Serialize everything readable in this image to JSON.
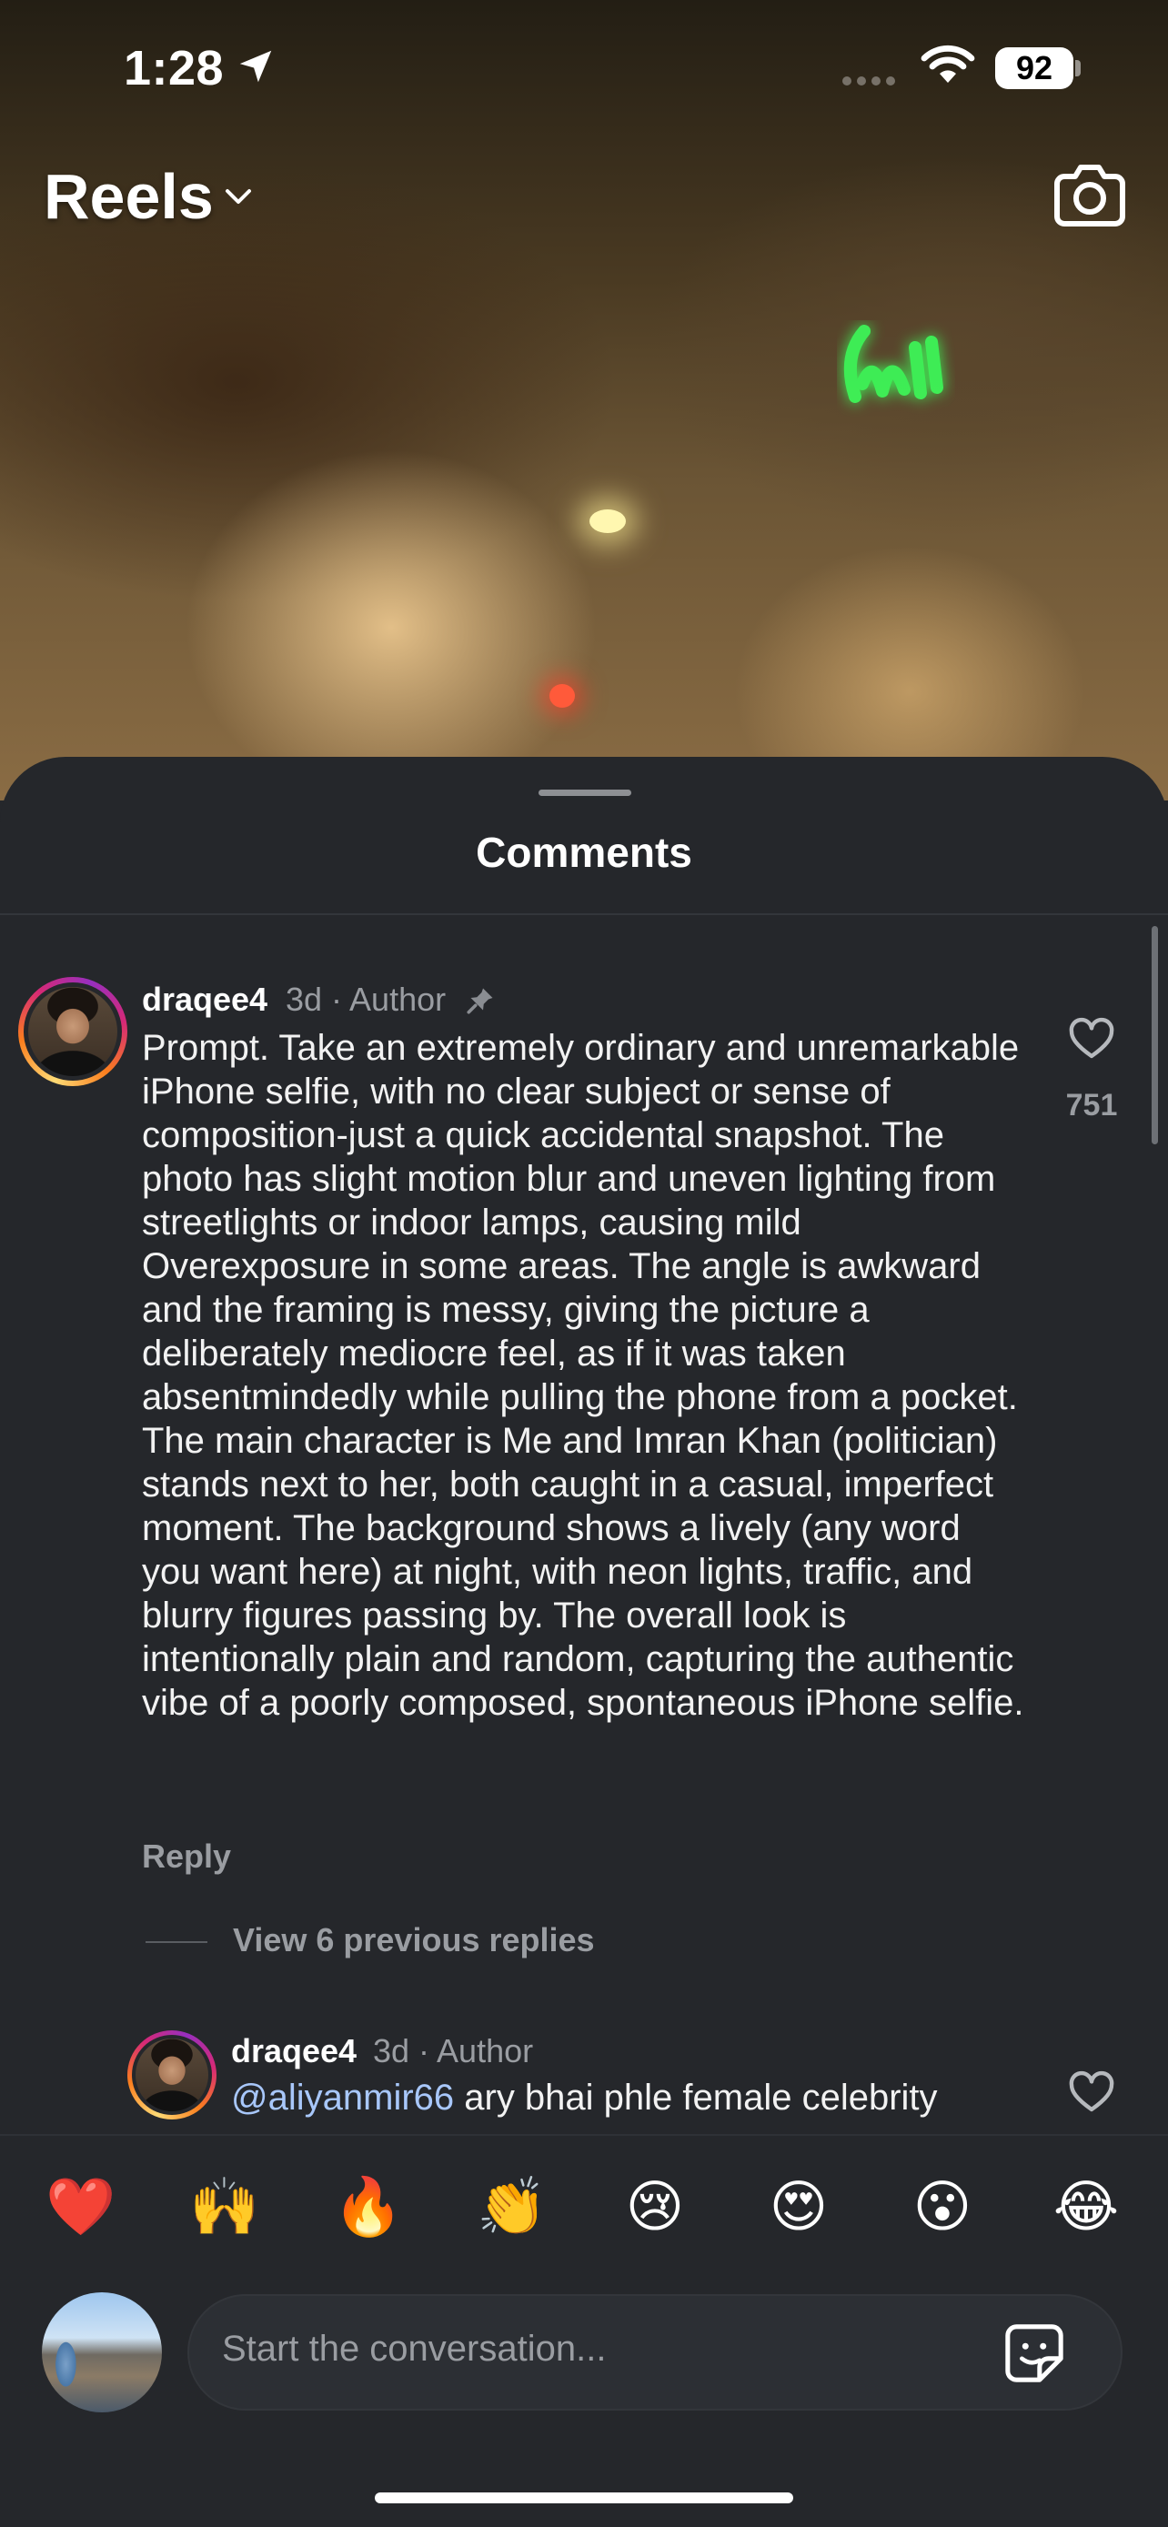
{
  "status_bar": {
    "time": "1:28",
    "battery": "92"
  },
  "header": {
    "title": "Reels"
  },
  "sheet": {
    "title": "Comments"
  },
  "comment": {
    "username": "draqee4",
    "meta": "3d · Author",
    "text": "Prompt.  Take an extremely ordinary and unremarkable iPhone selfie, with no clear subject or sense of composition-just a quick accidental snapshot. The photo has slight motion blur and uneven lighting from streetlights or indoor lamps, causing mild Overexposure in some areas. The angle is awkward and the framing is messy, giving the picture a deliberately mediocre feel, as if it was taken absentmindedly while pulling the phone from a pocket. The main character is Me and Imran Khan (politician) stands next to her, both caught in a casual, imperfect moment. The background shows a lively (any word you want here) at night, with neon lights, traffic, and blurry figures passing by. The overall look is intentionally plain and random, capturing the authentic vibe of a poorly composed, spontaneous iPhone selfie.",
    "like_count": "751",
    "reply_label": "Reply",
    "view_replies_label": "View 6 previous replies"
  },
  "reply": {
    "username": "draqee4",
    "meta": "3d · Author",
    "mention": "@aliyanmir66",
    "text": " ary bhai phle female celebrity"
  },
  "emoji_bar": [
    "❤️",
    "🙌",
    "🔥",
    "👏",
    "😢",
    "😍",
    "😮",
    "😂"
  ],
  "composer": {
    "placeholder": "Start the conversation..."
  },
  "icons": {
    "location": "location-arrow-icon",
    "wifi": "wifi-icon",
    "camera": "camera-icon",
    "chevron": "chevron-down-icon",
    "pin": "pin-icon",
    "heart": "heart-outline-icon",
    "sticker": "sticker-icon"
  },
  "colors": {
    "sheet_bg": "#25272b",
    "secondary_text": "#9a9da2",
    "mention": "#a8c7fa"
  }
}
